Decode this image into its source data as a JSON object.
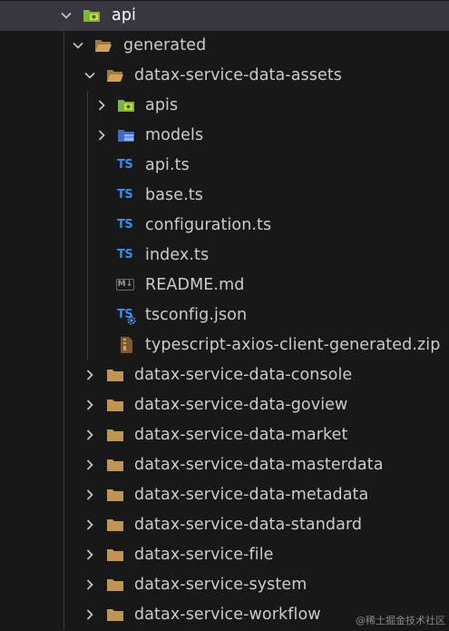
{
  "explorer": {
    "root": {
      "label": "api",
      "icon": "api-folder-icon"
    },
    "generated": {
      "label": "generated"
    },
    "assets": {
      "label": "datax-service-data-assets",
      "children": [
        {
          "label": "apis",
          "icon": "api-folder-icon",
          "kind": "folder"
        },
        {
          "label": "models",
          "icon": "models-folder-icon",
          "kind": "folder"
        },
        {
          "label": "api.ts",
          "icon": "typescript-icon",
          "kind": "file"
        },
        {
          "label": "base.ts",
          "icon": "typescript-icon",
          "kind": "file"
        },
        {
          "label": "configuration.ts",
          "icon": "typescript-icon",
          "kind": "file"
        },
        {
          "label": "index.ts",
          "icon": "typescript-icon",
          "kind": "file"
        },
        {
          "label": "README.md",
          "icon": "markdown-icon",
          "kind": "file"
        },
        {
          "label": "tsconfig.json",
          "icon": "tsconfig-icon",
          "kind": "file"
        },
        {
          "label": "typescript-axios-client-generated.zip",
          "icon": "zip-icon",
          "kind": "file"
        }
      ]
    },
    "services": [
      "datax-service-data-console",
      "datax-service-data-goview",
      "datax-service-data-market",
      "datax-service-data-masterdata",
      "datax-service-data-metadata",
      "datax-service-data-standard",
      "datax-service-file",
      "datax-service-system",
      "datax-service-workflow"
    ],
    "ts_badge": "TS",
    "md_badge": "M↓"
  },
  "watermark": "@稀土掘金技术社区",
  "colors": {
    "background": "#181818",
    "selected_row": "#37373d",
    "folder": "#c09553",
    "typescript": "#3b8eea",
    "api_folder": "#8bc34a"
  }
}
